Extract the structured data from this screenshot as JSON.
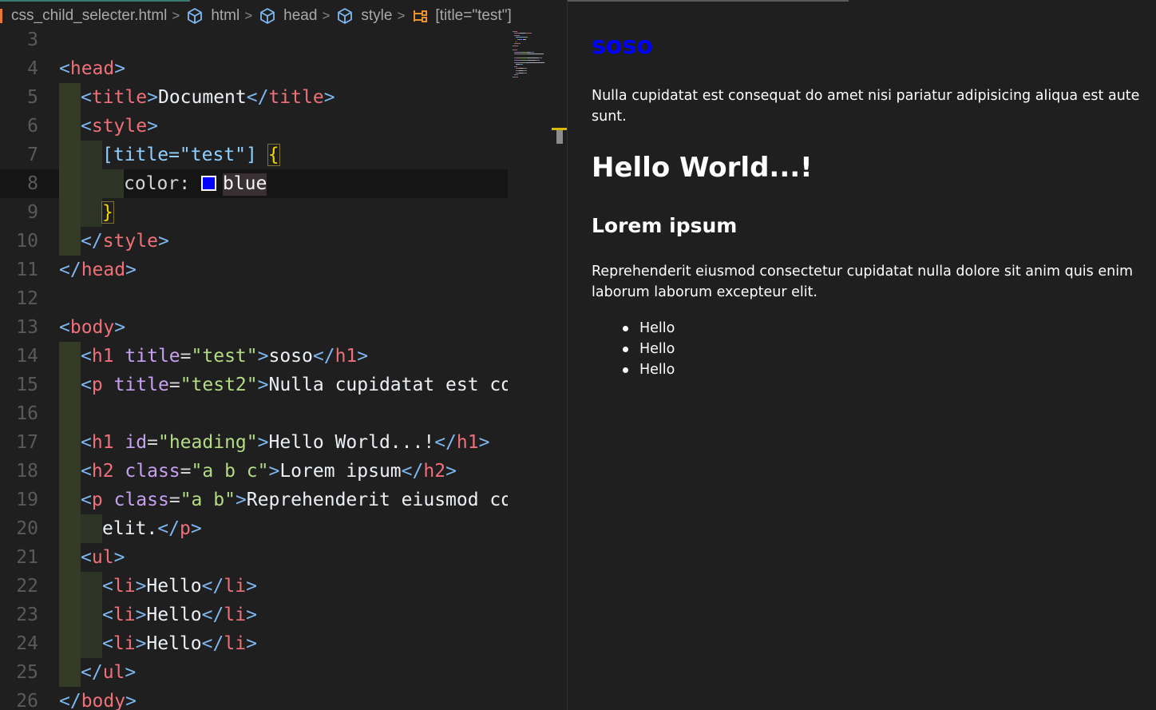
{
  "breadcrumb": {
    "file": "css_child_selecter.html",
    "items": [
      "html",
      "head",
      "style"
    ],
    "selector": "[title=\"test\"]"
  },
  "preview": {
    "h1_title_text": "soso",
    "h1_title_color": "#0000ff",
    "p1": "Nulla cupidatat est consequat do amet nisi pariatur adipisicing aliqua est aute sunt.",
    "h1_heading": "Hello World...!",
    "h2": "Lorem ipsum",
    "p2": "Reprehenderit eiusmod consectetur cupidatat nulla dolore sit anim quis enim laborum laborum excepteur elit.",
    "list_items": [
      "Hello",
      "Hello",
      "Hello"
    ]
  },
  "code_lines": [
    {
      "num": "3",
      "indent": 0,
      "tokens": []
    },
    {
      "num": "4",
      "indent": 0,
      "tokens": [
        [
          "br",
          "<"
        ],
        [
          "tag",
          "head"
        ],
        [
          "br",
          ">"
        ]
      ]
    },
    {
      "num": "5",
      "indent": 1,
      "tokens": [
        [
          "br",
          "<"
        ],
        [
          "tag",
          "title"
        ],
        [
          "br",
          ">"
        ],
        [
          "txt",
          "Document"
        ],
        [
          "br",
          "</"
        ],
        [
          "tag",
          "title"
        ],
        [
          "br",
          ">"
        ]
      ]
    },
    {
      "num": "6",
      "indent": 1,
      "tokens": [
        [
          "br",
          "<"
        ],
        [
          "tag",
          "style"
        ],
        [
          "br",
          ">"
        ]
      ]
    },
    {
      "num": "7",
      "indent": 2,
      "tokens": [
        [
          "sel",
          "[title=\"test\"] "
        ],
        [
          "brace",
          "{"
        ]
      ]
    },
    {
      "num": "8",
      "indent": 3,
      "current": true,
      "tokens": [
        [
          "prop",
          "color: "
        ],
        [
          "swatch",
          ""
        ],
        [
          "val",
          "blue"
        ]
      ]
    },
    {
      "num": "9",
      "indent": 2,
      "tokens": [
        [
          "brace",
          "}"
        ]
      ]
    },
    {
      "num": "10",
      "indent": 1,
      "tokens": [
        [
          "br",
          "</"
        ],
        [
          "tag",
          "style"
        ],
        [
          "br",
          ">"
        ]
      ]
    },
    {
      "num": "11",
      "indent": 0,
      "tokens": [
        [
          "br",
          "</"
        ],
        [
          "tag",
          "head"
        ],
        [
          "br",
          ">"
        ]
      ]
    },
    {
      "num": "12",
      "indent": 0,
      "tokens": []
    },
    {
      "num": "13",
      "indent": 0,
      "tokens": [
        [
          "br",
          "<"
        ],
        [
          "tag",
          "body"
        ],
        [
          "br",
          ">"
        ]
      ]
    },
    {
      "num": "14",
      "indent": 1,
      "tokens": [
        [
          "br",
          "<"
        ],
        [
          "tag",
          "h1"
        ],
        [
          "eq",
          " "
        ],
        [
          "attr",
          "title"
        ],
        [
          "eq",
          "="
        ],
        [
          "str",
          "\"test\""
        ],
        [
          "br",
          ">"
        ],
        [
          "txt",
          "soso"
        ],
        [
          "br",
          "</"
        ],
        [
          "tag",
          "h1"
        ],
        [
          "br",
          ">"
        ]
      ]
    },
    {
      "num": "15",
      "indent": 1,
      "tokens": [
        [
          "br",
          "<"
        ],
        [
          "tag",
          "p"
        ],
        [
          "eq",
          " "
        ],
        [
          "attr",
          "title"
        ],
        [
          "eq",
          "="
        ],
        [
          "str",
          "\"test2\""
        ],
        [
          "br",
          ">"
        ],
        [
          "txt",
          "Nulla cupidatat est cor"
        ]
      ]
    },
    {
      "num": "16",
      "indent": 1,
      "tokens": []
    },
    {
      "num": "17",
      "indent": 1,
      "tokens": [
        [
          "br",
          "<"
        ],
        [
          "tag",
          "h1"
        ],
        [
          "eq",
          " "
        ],
        [
          "attr",
          "id"
        ],
        [
          "eq",
          "="
        ],
        [
          "str",
          "\"heading\""
        ],
        [
          "br",
          ">"
        ],
        [
          "txt",
          "Hello World...!"
        ],
        [
          "br",
          "</"
        ],
        [
          "tag",
          "h1"
        ],
        [
          "br",
          ">"
        ]
      ]
    },
    {
      "num": "18",
      "indent": 1,
      "tokens": [
        [
          "br",
          "<"
        ],
        [
          "tag",
          "h2"
        ],
        [
          "eq",
          " "
        ],
        [
          "attr",
          "class"
        ],
        [
          "eq",
          "="
        ],
        [
          "str",
          "\"a b c\""
        ],
        [
          "br",
          ">"
        ],
        [
          "txt",
          "Lorem ipsum"
        ],
        [
          "br",
          "</"
        ],
        [
          "tag",
          "h2"
        ],
        [
          "br",
          ">"
        ]
      ]
    },
    {
      "num": "19",
      "indent": 1,
      "tokens": [
        [
          "br",
          "<"
        ],
        [
          "tag",
          "p"
        ],
        [
          "eq",
          " "
        ],
        [
          "attr",
          "class"
        ],
        [
          "eq",
          "="
        ],
        [
          "str",
          "\"a b\""
        ],
        [
          "br",
          ">"
        ],
        [
          "txt",
          "Reprehenderit eiusmod cor"
        ]
      ]
    },
    {
      "num": "20",
      "indent": 2,
      "tokens": [
        [
          "txt",
          "elit."
        ],
        [
          "br",
          "</"
        ],
        [
          "tag",
          "p"
        ],
        [
          "br",
          ">"
        ]
      ]
    },
    {
      "num": "21",
      "indent": 1,
      "tokens": [
        [
          "br",
          "<"
        ],
        [
          "tag",
          "ul"
        ],
        [
          "br",
          ">"
        ]
      ]
    },
    {
      "num": "22",
      "indent": 2,
      "tokens": [
        [
          "br",
          "<"
        ],
        [
          "tag",
          "li"
        ],
        [
          "br",
          ">"
        ],
        [
          "txt",
          "Hello"
        ],
        [
          "br",
          "</"
        ],
        [
          "tag",
          "li"
        ],
        [
          "br",
          ">"
        ]
      ]
    },
    {
      "num": "23",
      "indent": 2,
      "tokens": [
        [
          "br",
          "<"
        ],
        [
          "tag",
          "li"
        ],
        [
          "br",
          ">"
        ],
        [
          "txt",
          "Hello"
        ],
        [
          "br",
          "</"
        ],
        [
          "tag",
          "li"
        ],
        [
          "br",
          ">"
        ]
      ]
    },
    {
      "num": "24",
      "indent": 2,
      "tokens": [
        [
          "br",
          "<"
        ],
        [
          "tag",
          "li"
        ],
        [
          "br",
          ">"
        ],
        [
          "txt",
          "Hello"
        ],
        [
          "br",
          "</"
        ],
        [
          "tag",
          "li"
        ],
        [
          "br",
          ">"
        ]
      ]
    },
    {
      "num": "25",
      "indent": 1,
      "tokens": [
        [
          "br",
          "</"
        ],
        [
          "tag",
          "ul"
        ],
        [
          "br",
          ">"
        ]
      ]
    },
    {
      "num": "26",
      "indent": 0,
      "tokens": [
        [
          "br",
          "</"
        ],
        [
          "tag",
          "body"
        ],
        [
          "br",
          ">"
        ]
      ]
    }
  ]
}
